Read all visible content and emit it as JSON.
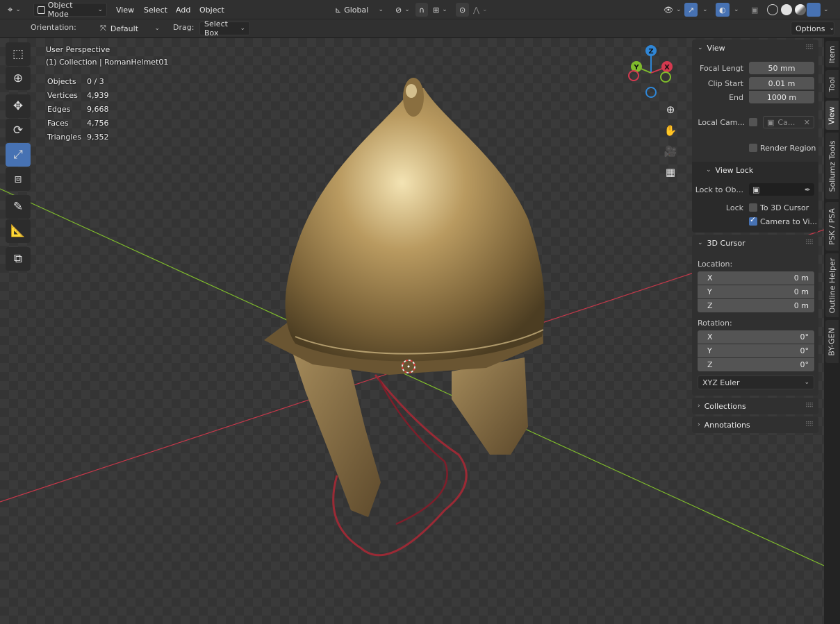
{
  "header": {
    "editor_icon": "3d-viewport-icon",
    "mode": "Object Mode",
    "menus": [
      "View",
      "Select",
      "Add",
      "Object"
    ],
    "transform_orientation": "Global"
  },
  "tool_settings": {
    "orientation_label": "Orientation:",
    "orientation_value": "Default",
    "drag_label": "Drag:",
    "drag_value": "Select Box",
    "options_label": "Options"
  },
  "viewport": {
    "view_name": "User Perspective",
    "collection_info": "(1) Collection | RomanHelmet01",
    "stats": [
      {
        "label": "Objects",
        "value": "0 / 3"
      },
      {
        "label": "Vertices",
        "value": "4,939"
      },
      {
        "label": "Edges",
        "value": "9,668"
      },
      {
        "label": "Faces",
        "value": "4,756"
      },
      {
        "label": "Triangles",
        "value": "9,352"
      }
    ],
    "gizmo": {
      "x": "X",
      "y": "Y",
      "z": "Z"
    }
  },
  "sidebar": {
    "view_panel": {
      "title": "View",
      "focal_length_label": "Focal Lengt",
      "focal_length": "50 mm",
      "clip_start_label": "Clip Start",
      "clip_start": "0.01 m",
      "end_label": "End",
      "end": "1000 m",
      "local_camera_label": "Local Cam...",
      "local_camera_value": "Ca...",
      "render_region_label": "Render Region"
    },
    "view_lock_panel": {
      "title": "View Lock",
      "lock_to_object_label": "Lock to Ob...",
      "lock_label": "Lock",
      "to_3d_cursor_label": "To 3D Cursor",
      "camera_to_view_label": "Camera to Vi...",
      "camera_to_view_checked": true
    },
    "cursor_panel": {
      "title": "3D Cursor",
      "location_label": "Location:",
      "location": [
        {
          "axis": "X",
          "value": "0 m"
        },
        {
          "axis": "Y",
          "value": "0 m"
        },
        {
          "axis": "Z",
          "value": "0 m"
        }
      ],
      "rotation_label": "Rotation:",
      "rotation": [
        {
          "axis": "X",
          "value": "0°"
        },
        {
          "axis": "Y",
          "value": "0°"
        },
        {
          "axis": "Z",
          "value": "0°"
        }
      ],
      "rotation_mode": "XYZ Euler"
    },
    "collections_title": "Collections",
    "annotations_title": "Annotations"
  },
  "tabs": [
    "Item",
    "Tool",
    "View",
    "Sollumz Tools",
    "PSK / PSA",
    "Outline Helper",
    "BY-GEN"
  ],
  "active_tab": "View",
  "colors": {
    "accent": "#4772b3",
    "x_axis": "#d3394f",
    "y_axis": "#7fbb2c",
    "z_axis": "#2f86d6"
  }
}
